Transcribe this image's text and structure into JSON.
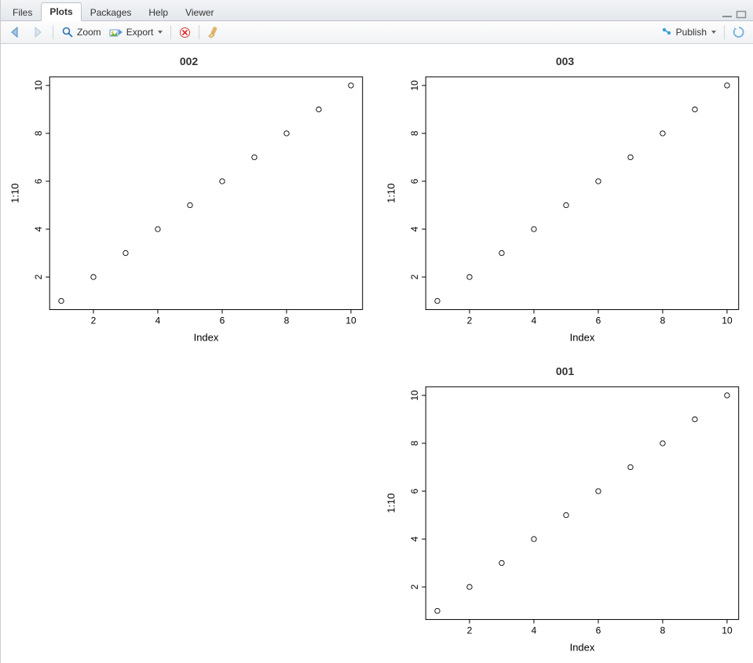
{
  "tabs": {
    "items": [
      "Files",
      "Plots",
      "Packages",
      "Help",
      "Viewer"
    ],
    "active_index": 1
  },
  "toolbar": {
    "zoom_label": "Zoom",
    "export_label": "Export",
    "publish_label": "Publish"
  },
  "chart_data": [
    {
      "type": "scatter",
      "title": "002",
      "xlabel": "Index",
      "ylabel": "1:10",
      "x": [
        1,
        2,
        3,
        4,
        5,
        6,
        7,
        8,
        9,
        10
      ],
      "y": [
        1,
        2,
        3,
        4,
        5,
        6,
        7,
        8,
        9,
        10
      ],
      "xlim": [
        1,
        10
      ],
      "ylim": [
        1,
        10
      ],
      "xticks": [
        2,
        4,
        6,
        8,
        10
      ],
      "yticks": [
        2,
        4,
        6,
        8,
        10
      ],
      "grid_pos": 0
    },
    {
      "type": "scatter",
      "title": "003",
      "xlabel": "Index",
      "ylabel": "1:10",
      "x": [
        1,
        2,
        3,
        4,
        5,
        6,
        7,
        8,
        9,
        10
      ],
      "y": [
        1,
        2,
        3,
        4,
        5,
        6,
        7,
        8,
        9,
        10
      ],
      "xlim": [
        1,
        10
      ],
      "ylim": [
        1,
        10
      ],
      "xticks": [
        2,
        4,
        6,
        8,
        10
      ],
      "yticks": [
        2,
        4,
        6,
        8,
        10
      ],
      "grid_pos": 1
    },
    {
      "type": "scatter",
      "title": "001",
      "xlabel": "Index",
      "ylabel": "1:10",
      "x": [
        1,
        2,
        3,
        4,
        5,
        6,
        7,
        8,
        9,
        10
      ],
      "y": [
        1,
        2,
        3,
        4,
        5,
        6,
        7,
        8,
        9,
        10
      ],
      "xlim": [
        1,
        10
      ],
      "ylim": [
        1,
        10
      ],
      "xticks": [
        2,
        4,
        6,
        8,
        10
      ],
      "yticks": [
        2,
        4,
        6,
        8,
        10
      ],
      "grid_pos": 3
    }
  ]
}
